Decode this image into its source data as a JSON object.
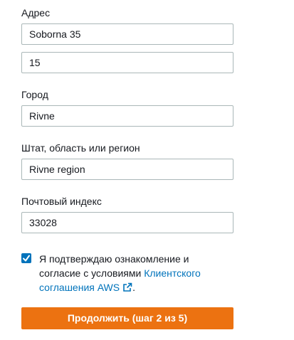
{
  "address": {
    "label": "Адрес",
    "line1_value": "Soborna 35",
    "line2_value": "15"
  },
  "city": {
    "label": "Город",
    "value": "Rivne"
  },
  "state": {
    "label": "Штат, область или регион",
    "value": "Rivne region"
  },
  "postal_code": {
    "label": "Почтовый индекс",
    "value": "33028"
  },
  "agreement": {
    "checked": true,
    "text_before": "Я подтверждаю ознакомление и согласие с условиями ",
    "link_text": "Клиентского соглашения AWS",
    "text_after": ".",
    "link_icon": "external-link-icon",
    "checkbox_icon": "checkmark-icon"
  },
  "continue_button": {
    "label": "Продолжить (шаг 2 из 5)"
  },
  "colors": {
    "accent_orange": "#ec7211",
    "link_blue": "#0073bb",
    "checkbox_blue": "#0073bb",
    "border_gray": "#aab7b8",
    "text": "#16191f"
  }
}
